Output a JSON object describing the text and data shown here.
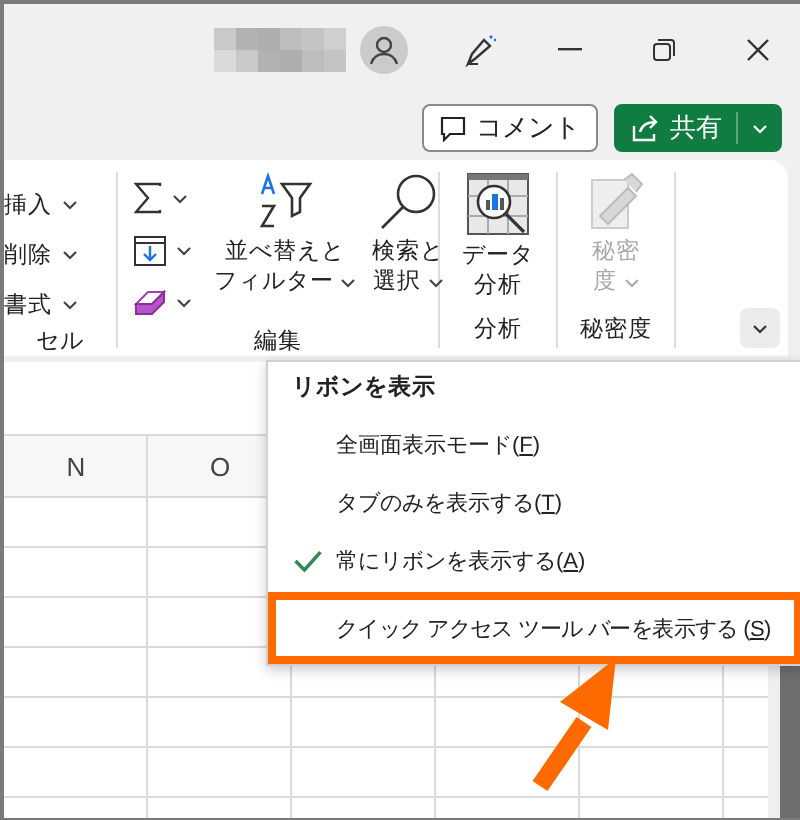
{
  "actions": [
    {
      "kind": "outline",
      "label": "コメント"
    },
    {
      "kind": "primary",
      "label": "共有"
    }
  ],
  "ribbon": {
    "groups": [
      {
        "kind": "cells",
        "label": "セル",
        "items": [
          {
            "label": "挿入",
            "dropdown": true
          },
          {
            "label": "削除",
            "dropdown": true
          },
          {
            "label": "書式",
            "dropdown": true
          }
        ]
      },
      {
        "kind": "editing",
        "label": "編集",
        "items": [
          {
            "lines": [
              "並べ替えと",
              "フィルター"
            ],
            "dropdown": true,
            "disabled": false
          },
          {
            "lines": [
              "検索と",
              "選択"
            ],
            "dropdown": true,
            "disabled": false
          }
        ]
      },
      {
        "kind": "analysis",
        "label": "分析",
        "items": [
          {
            "lines": [
              "データ",
              "分析"
            ],
            "dropdown": false,
            "disabled": false
          }
        ]
      },
      {
        "kind": "sensitivity",
        "label": "秘密度",
        "items": [
          {
            "lines": [
              "秘密",
              "度"
            ],
            "dropdown": true,
            "disabled": true
          }
        ]
      }
    ]
  },
  "sheet": {
    "columns": [
      "N",
      "O"
    ]
  },
  "context_menu": {
    "title": "リボンを表示",
    "items": [
      {
        "label": "全画面表示モード(F)",
        "checked": false,
        "highlighted": false
      },
      {
        "label": "タブのみを表示する(T)",
        "checked": false,
        "highlighted": false
      },
      {
        "label": "常にリボンを表示する(A)",
        "checked": true,
        "highlighted": false
      },
      {
        "label": "クイック アクセス ツール バーを表示する (S)",
        "checked": false,
        "highlighted": true
      }
    ]
  }
}
